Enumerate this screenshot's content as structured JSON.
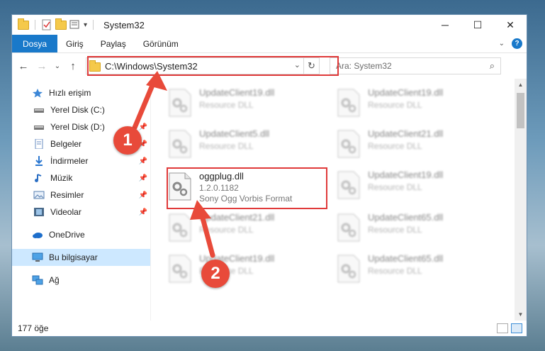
{
  "window": {
    "title": "System32",
    "controls": {
      "minimize": "─",
      "maximize": "☐",
      "close": "✕"
    }
  },
  "ribbon": {
    "tabs": [
      "Dosya",
      "Giriş",
      "Paylaş",
      "Görünüm"
    ],
    "help": "?"
  },
  "nav": {
    "back": "←",
    "forward": "→",
    "recent": "⌄",
    "up": "↑",
    "address": "C:\\Windows\\System32",
    "search_placeholder": "Ara: System32"
  },
  "sidebar": {
    "items": [
      {
        "label": "Hızlı erişim",
        "icon": "star-icon"
      },
      {
        "label": "Yerel Disk (C:)",
        "icon": "drive-icon"
      },
      {
        "label": "Yerel Disk (D:)",
        "icon": "drive-icon"
      },
      {
        "label": "Belgeler",
        "icon": "documents-icon"
      },
      {
        "label": "İndirmeler",
        "icon": "download-icon"
      },
      {
        "label": "Müzik",
        "icon": "music-icon"
      },
      {
        "label": "Resimler",
        "icon": "pictures-icon"
      },
      {
        "label": "Videolar",
        "icon": "videos-icon"
      },
      {
        "label": "OneDrive",
        "icon": "cloud-icon"
      },
      {
        "label": "Bu bilgisayar",
        "icon": "computer-icon"
      },
      {
        "label": "Ağ",
        "icon": "network-icon"
      }
    ]
  },
  "files": {
    "highlighted": {
      "name": "oggplug.dll",
      "version": "1.2.0.1182",
      "description": "Sony Ogg Vorbis Format"
    },
    "left_blurred": [
      {
        "name": "UpdateClient19.dll",
        "type": "Resource DLL"
      },
      {
        "name": "UpdateClient5.dll",
        "type": "Resource DLL"
      },
      {
        "name": "UpdateClient21.dll",
        "type": "Resource DLL"
      },
      {
        "name": "UpdateClient19.dll",
        "type": "Resource DLL"
      }
    ],
    "right_blurred": [
      {
        "name": "UpdateClient19.dll",
        "type": "Resource DLL"
      },
      {
        "name": "UpdateClient21.dll",
        "type": "Resource DLL"
      },
      {
        "name": "UpdateClient19.dll",
        "type": "Resource DLL"
      },
      {
        "name": "UpdateClient65.dll",
        "type": "Resource DLL"
      },
      {
        "name": "UpdateClient65.dll",
        "type": "Resource DLL"
      }
    ]
  },
  "status": {
    "count": "177 öğe"
  },
  "annotations": {
    "step1": "1",
    "step2": "2"
  },
  "colors": {
    "accent": "#1979ca",
    "highlight_box": "#e03a3a",
    "badge": "#e84a3a"
  }
}
